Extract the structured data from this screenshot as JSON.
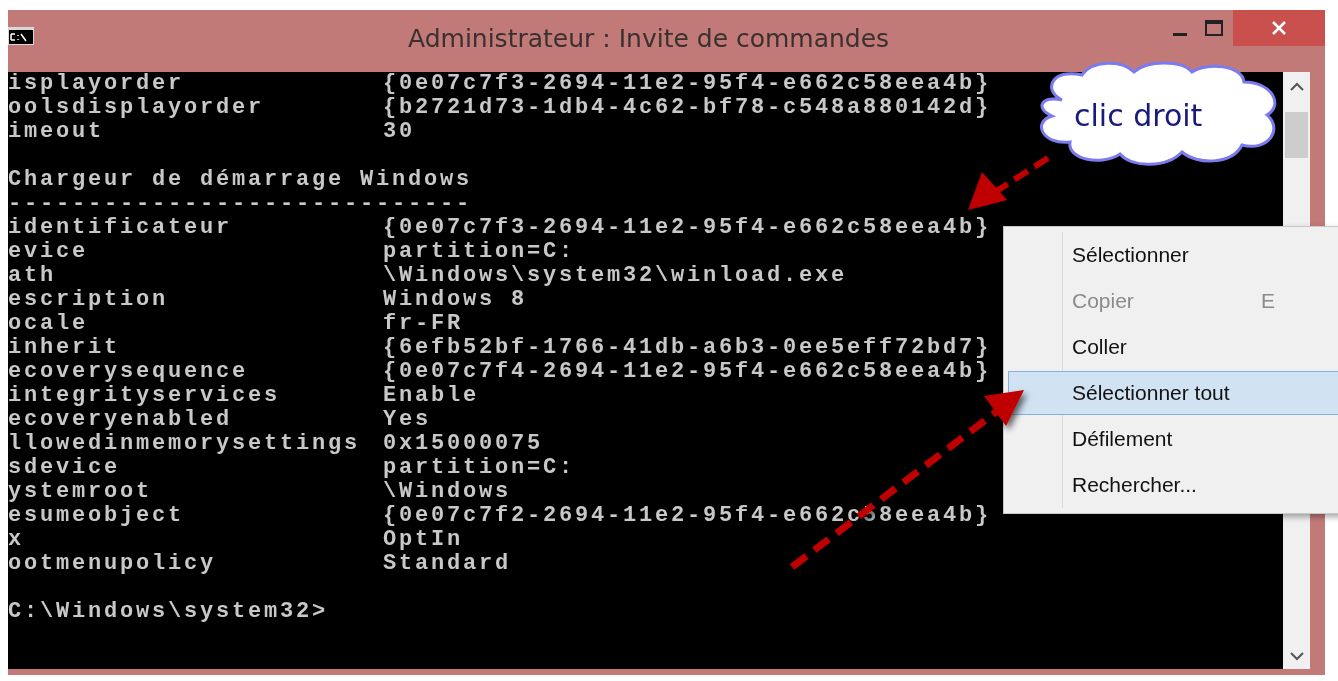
{
  "window": {
    "title": "Administrateur : Invite de commandes"
  },
  "console": {
    "lines": [
      {
        "kind": "pair",
        "name": "isplayorder",
        "value": "{0e07c7f3-2694-11e2-95f4-e662c58eea4b}"
      },
      {
        "kind": "pair",
        "name": "oolsdisplayorder",
        "value": "{b2721d73-1db4-4c62-bf78-c548a880142d}"
      },
      {
        "kind": "pair",
        "name": "imeout",
        "value": "30"
      },
      {
        "kind": "blank"
      },
      {
        "kind": "text",
        "text": "Chargeur de démarrage Windows"
      },
      {
        "kind": "text",
        "text": "-----------------------------"
      },
      {
        "kind": "pair",
        "name": "identificateur",
        "value": "{0e07c7f3-2694-11e2-95f4-e662c58eea4b}"
      },
      {
        "kind": "pair",
        "name": "evice",
        "value": "partition=C:"
      },
      {
        "kind": "pair",
        "name": "ath",
        "value": "\\Windows\\system32\\winload.exe"
      },
      {
        "kind": "pair",
        "name": "escription",
        "value": "Windows 8"
      },
      {
        "kind": "pair",
        "name": "ocale",
        "value": "fr-FR"
      },
      {
        "kind": "pair",
        "name": "inherit",
        "value": "{6efb52bf-1766-41db-a6b3-0ee5eff72bd7}"
      },
      {
        "kind": "pair",
        "name": "ecoverysequence",
        "value": "{0e07c7f4-2694-11e2-95f4-e662c58eea4b}"
      },
      {
        "kind": "pair",
        "name": "integrityservices",
        "value": "Enable"
      },
      {
        "kind": "pair",
        "name": "ecoveryenabled",
        "value": "Yes"
      },
      {
        "kind": "pair",
        "name": "llowedinmemorysettings",
        "value": "0x15000075"
      },
      {
        "kind": "pair",
        "name": "sdevice",
        "value": "partition=C:"
      },
      {
        "kind": "pair",
        "name": "ystemroot",
        "value": "\\Windows"
      },
      {
        "kind": "pair",
        "name": "esumeobject",
        "value": "{0e07c7f2-2694-11e2-95f4-e662c58eea4b}"
      },
      {
        "kind": "pair",
        "name": "x",
        "value": "OptIn"
      },
      {
        "kind": "pair",
        "name": "ootmenupolicy",
        "value": "Standard"
      },
      {
        "kind": "blank"
      },
      {
        "kind": "text",
        "text": "C:\\Windows\\system32>"
      }
    ]
  },
  "context_menu": {
    "items": [
      {
        "label": "Sélectionner",
        "disabled": false,
        "selected": false
      },
      {
        "label": "Copier",
        "shortcut": "E",
        "disabled": true,
        "selected": false
      },
      {
        "label": "Coller",
        "disabled": false,
        "selected": false
      },
      {
        "label": "Sélectionner tout",
        "disabled": false,
        "selected": true
      },
      {
        "label": "Défilement",
        "disabled": false,
        "selected": false
      },
      {
        "label": "Rechercher...",
        "disabled": false,
        "selected": false
      }
    ]
  },
  "callout": {
    "text": "clic droit"
  }
}
